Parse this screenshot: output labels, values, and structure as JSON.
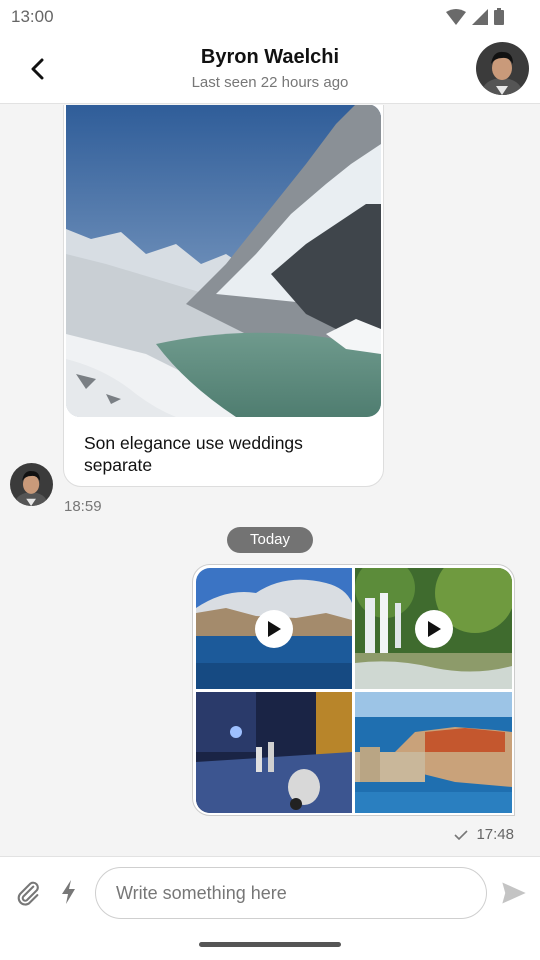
{
  "status_bar": {
    "time": "13:00",
    "icons": [
      "wifi-icon",
      "signal-icon",
      "battery-icon"
    ]
  },
  "header": {
    "contact_name": "Byron Waelchi",
    "last_seen": "Last seen 22 hours ago",
    "back_icon": "chevron-left-icon",
    "avatar": "contact-avatar"
  },
  "messages": {
    "incoming": {
      "image": "snowy-mountain-lake-photo",
      "text": "Son elegance use weddings separate",
      "time": "18:59"
    },
    "date_divider": "Today",
    "outgoing": {
      "media": [
        {
          "kind": "video",
          "subject": "lake-with-mountains"
        },
        {
          "kind": "video",
          "subject": "waterfall"
        },
        {
          "kind": "photo",
          "subject": "night-street-scooter"
        },
        {
          "kind": "photo",
          "subject": "coastal-walled-city"
        }
      ],
      "status": "delivered-check",
      "time": "17:48"
    }
  },
  "composer": {
    "placeholder": "Write something here",
    "value": ""
  },
  "colors": {
    "background": "#f4f4f4",
    "bubble": "#ffffff",
    "date_pill": "#737373",
    "muted_text": "#777777"
  }
}
